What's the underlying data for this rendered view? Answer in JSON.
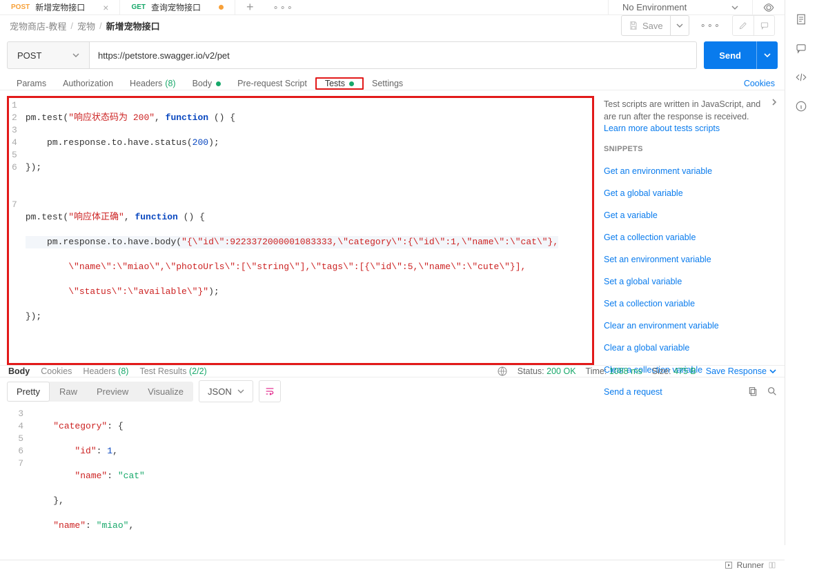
{
  "tabs": [
    {
      "method": "POST",
      "title": "新增宠物接口",
      "hasDirty": false
    },
    {
      "method": "GET",
      "title": "查询宠物接口",
      "hasDirty": true
    }
  ],
  "envSelector": {
    "label": "No Environment"
  },
  "breadcrumbs": {
    "a": "宠物商店-教程",
    "b": "宠物",
    "c": "新增宠物接口"
  },
  "saveLabel": "Save",
  "request": {
    "method": "POST",
    "url": "https://petstore.swagger.io/v2/pet",
    "sendLabel": "Send"
  },
  "reqTabs": {
    "params": "Params",
    "auth": "Authorization",
    "headers": "Headers",
    "headersCount": "(8)",
    "body": "Body",
    "prereq": "Pre-request Script",
    "tests": "Tests",
    "settings": "Settings",
    "cookies": "Cookies"
  },
  "testCode": {
    "l1a": "pm.test(",
    "l1s": "\"响应状态码为 200\"",
    "l1b": ", ",
    "l1kw": "function",
    "l1c": " () {",
    "l2a": "    pm.response.to.have.status(",
    "l2n": "200",
    "l2b": ");",
    "l3": "});",
    "l5a": "pm.test(",
    "l5s": "\"响应体正确\"",
    "l5b": ", ",
    "l5kw": "function",
    "l5c": " () {",
    "l6a": "    pm.response.to.have.body(",
    "l6s1": "\"{\\\"id\\\":9223372000001083333,\\\"category\\\":{\\\"id\\\":1,\\\"name\\\":\\\"cat\\\"},",
    "l6s2": "        \\\"name\\\":\\\"miao\\\",\\\"photoUrls\\\":[\\\"string\\\"],\\\"tags\\\":[{\\\"id\\\":5,\\\"name\\\":\\\"cute\\\"}],",
    "l6s3": "        \\\"status\\\":\\\"available\\\"}\"",
    "l6b": ");",
    "l7": "});"
  },
  "snippetsPanel": {
    "infoText": "Test scripts are written in JavaScript, and are run after the response is received.",
    "learnLink": "Learn more about tests scripts",
    "heading": "SNIPPETS",
    "items": [
      "Get an environment variable",
      "Get a global variable",
      "Get a variable",
      "Get a collection variable",
      "Set an environment variable",
      "Set a global variable",
      "Set a collection variable",
      "Clear an environment variable",
      "Clear a global variable",
      "Clear a collection variable",
      "Send a request"
    ]
  },
  "response": {
    "tabs": {
      "body": "Body",
      "cookies": "Cookies",
      "headers": "Headers",
      "headersCount": "(8)",
      "testResults": "Test Results",
      "testCount": "(2/2)"
    },
    "statusLabel": "Status:",
    "statusVal": "200 OK",
    "timeLabel": "Time:",
    "timeVal": "1088 ms",
    "sizeLabel": "Size:",
    "sizeVal": "475 B",
    "saveResp": "Save Response"
  },
  "viewBar": {
    "pretty": "Pretty",
    "raw": "Raw",
    "preview": "Preview",
    "visualize": "Visualize",
    "jsonLabel": "JSON"
  },
  "respBody": {
    "l3a": "    ",
    "l3k": "\"category\"",
    "l3b": ": {",
    "l4a": "        ",
    "l4k": "\"id\"",
    "l4b": ": ",
    "l4v": "1",
    "l4c": ",",
    "l5a": "        ",
    "l5k": "\"name\"",
    "l5b": ": ",
    "l5v": "\"cat\"",
    "l6a": "    },",
    "l7a": "    ",
    "l7k": "\"name\"",
    "l7b": ": ",
    "l7v": "\"miao\"",
    "l7c": ","
  },
  "footer": {
    "runner": "Runner"
  }
}
